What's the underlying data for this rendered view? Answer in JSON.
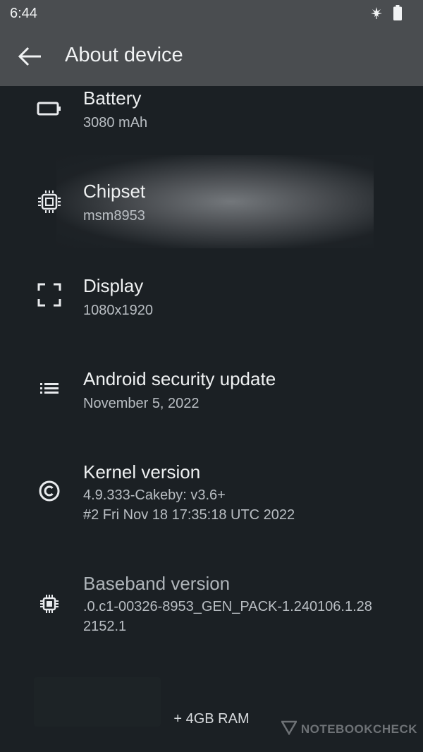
{
  "status_bar": {
    "time": "6:44",
    "icons": [
      "leaf-icon",
      "battery-icon"
    ]
  },
  "app_bar": {
    "title": "About device",
    "back_icon": "arrow-back-icon"
  },
  "items": [
    {
      "title": "Battery",
      "summary": "3080 mAh",
      "icon": "battery-outline-icon"
    },
    {
      "title": "Chipset",
      "summary": "msm8953",
      "icon": "cpu-icon"
    },
    {
      "title": "Display",
      "summary": "1080x1920",
      "icon": "display-frame-icon"
    },
    {
      "title": "Android security update",
      "summary": "November 5, 2022",
      "icon": "list-icon"
    },
    {
      "title": "Kernel version",
      "summary_lines": [
        "4.9.333-Cakeby: v3.6+",
        "#2 Fri Nov 18 17:35:18 UTC 2022"
      ],
      "icon": "copyright-icon"
    },
    {
      "title": "Baseband version",
      "summary_lines": [
        ".0.c1-00326-8953_GEN_PACK-1.240106.1.28",
        "2152.1"
      ],
      "icon": "chip-icon"
    }
  ],
  "footer": {
    "text": "+ 4GB RAM"
  },
  "watermark": {
    "text": "NOTEBOOKCHECK"
  },
  "colors": {
    "background": "#1b2024",
    "app_bar": "#4a4d50",
    "primary_text": "#eef0f1",
    "secondary_text": "#b9bec3"
  }
}
